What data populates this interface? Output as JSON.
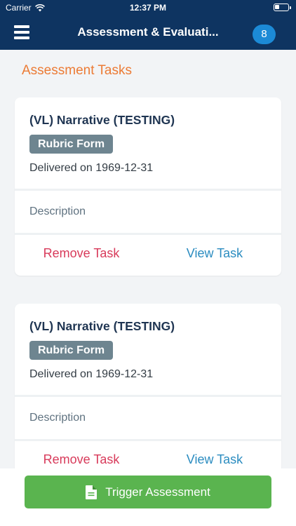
{
  "status_bar": {
    "carrier": "Carrier",
    "time": "12:37 PM"
  },
  "header": {
    "title": "Assessment & Evaluati...",
    "badge_count": "8"
  },
  "section_title": "Assessment Tasks",
  "tasks": [
    {
      "title": "(VL) Narrative (TESTING)",
      "form_type": "Rubric Form",
      "delivered": "Delivered on 1969-12-31",
      "description_label": "Description",
      "remove_label": "Remove Task",
      "view_label": "View Task"
    },
    {
      "title": "(VL) Narrative (TESTING)",
      "form_type": "Rubric Form",
      "delivered": "Delivered on 1969-12-31",
      "description_label": "Description",
      "remove_label": "Remove Task",
      "view_label": "View Task"
    }
  ],
  "trigger_button": {
    "label": "Trigger Assessment",
    "icon": "document-icon"
  },
  "colors": {
    "header_bg": "#0e3461",
    "accent_orange": "#ec7b35",
    "remove_red": "#d83a5a",
    "view_blue": "#2b8cc0",
    "trigger_green": "#5ab44f",
    "badge_blue": "#1c8ad6"
  }
}
